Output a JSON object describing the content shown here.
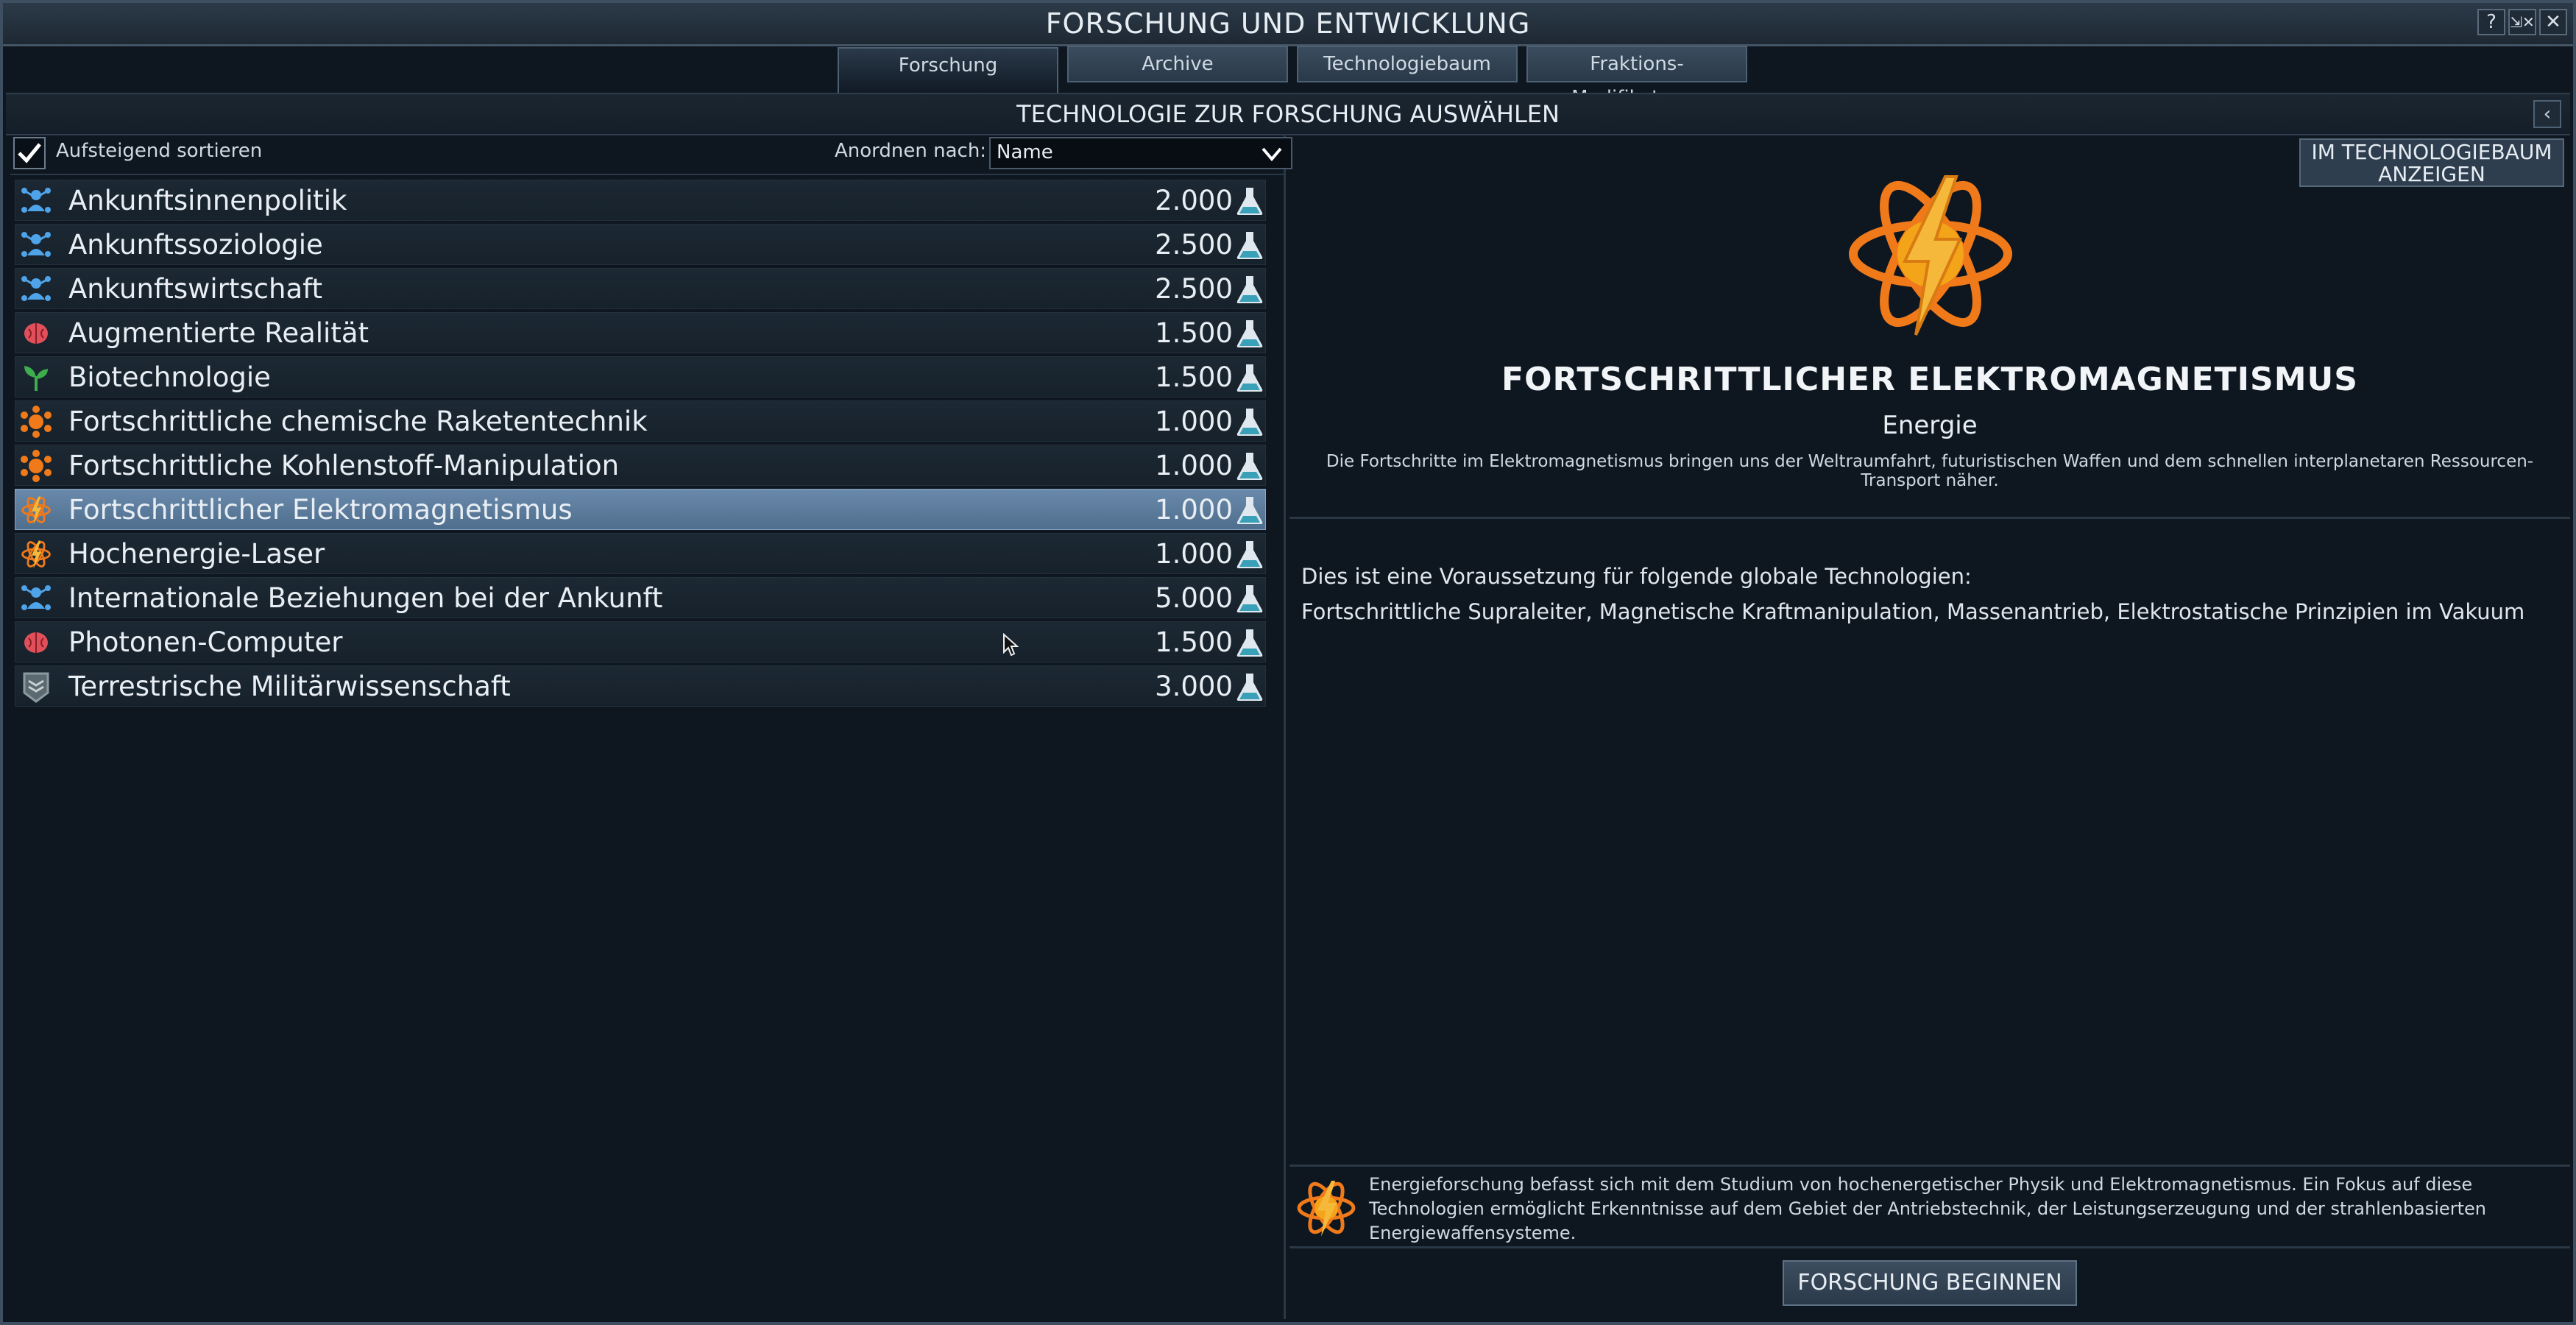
{
  "window": {
    "title": "FORSCHUNG UND ENTWICKLUNG",
    "buttons": {
      "help": "?",
      "pin": "⇲✕",
      "close": "✕"
    }
  },
  "tabs": [
    {
      "label": "Forschung",
      "active": true
    },
    {
      "label": "Archive",
      "active": false
    },
    {
      "label": "Technologiebaum",
      "active": false
    },
    {
      "label": "Fraktions-Modifikatoren",
      "active": false
    }
  ],
  "section": {
    "title": "TECHNOLOGIE ZUR FORSCHUNG AUSWÄHLEN",
    "collapse": "‹"
  },
  "sort": {
    "ascending_label": "Aufsteigend sortieren",
    "ascending_checked": true,
    "arrange_label": "Anordnen nach:",
    "arrange_value": "Name"
  },
  "technologies": [
    {
      "name": "Ankunftsinnenpolitik",
      "cost": "2.000",
      "icon": "social-icon",
      "selected": false
    },
    {
      "name": "Ankunftssoziologie",
      "cost": "2.500",
      "icon": "social-icon",
      "selected": false
    },
    {
      "name": "Ankunftswirtschaft",
      "cost": "2.500",
      "icon": "social-icon",
      "selected": false
    },
    {
      "name": "Augmentierte Realität",
      "cost": "1.500",
      "icon": "brain-icon",
      "selected": false
    },
    {
      "name": "Biotechnologie",
      "cost": "1.500",
      "icon": "sprout-icon",
      "selected": false
    },
    {
      "name": "Fortschrittliche chemische Raketentechnik",
      "cost": "1.000",
      "icon": "materials-icon",
      "selected": false
    },
    {
      "name": "Fortschrittliche Kohlenstoff-Manipulation",
      "cost": "1.000",
      "icon": "materials-icon",
      "selected": false
    },
    {
      "name": "Fortschrittlicher Elektromagnetismus",
      "cost": "1.000",
      "icon": "energy-icon",
      "selected": true
    },
    {
      "name": "Hochenergie-Laser",
      "cost": "1.000",
      "icon": "energy-icon",
      "selected": false
    },
    {
      "name": "Internationale Beziehungen bei der Ankunft",
      "cost": "5.000",
      "icon": "social-icon",
      "selected": false
    },
    {
      "name": "Photonen-Computer",
      "cost": "1.500",
      "icon": "brain-icon",
      "selected": false
    },
    {
      "name": "Terrestrische Militärwissenschaft",
      "cost": "3.000",
      "icon": "military-icon",
      "selected": false
    }
  ],
  "detail": {
    "tree_button": "IM TECHNOLOGIEBAUM ANZEIGEN",
    "title": "FORTSCHRITTLICHER ELEKTROMAGNETISMUS",
    "category": "Energie",
    "description": "Die Fortschritte im Elektromagnetismus bringen uns der Weltraumfahrt, futuristischen Waffen und dem schnellen interplanetaren Ressourcen-Transport näher.",
    "prereq_intro": "Dies ist eine Voraussetzung für folgende globale Technologien:",
    "prereq_list": "Fortschrittliche Supraleiter, Magnetische Kraftmanipulation, Massenantrieb, Elektrostatische Prinzipien im Vakuum",
    "category_info": "Energieforschung befasst sich mit dem Studium von hochenergetischer Physik und Elektromagnetismus. Ein Fokus auf diese Technologien ermöglicht Erkenntnisse auf dem Gebiet der Antriebstechnik, der Leistungserzeugung und der strahlenbasierten Energiewaffensysteme.",
    "start_button": "FORSCHUNG BEGINNEN"
  },
  "colors": {
    "energy": "#f07a1a",
    "social": "#4fa3e8",
    "brain": "#e0505a",
    "sprout": "#3cae4c",
    "military": "#8a9aa0",
    "selected_row": "#5d7d9e"
  }
}
